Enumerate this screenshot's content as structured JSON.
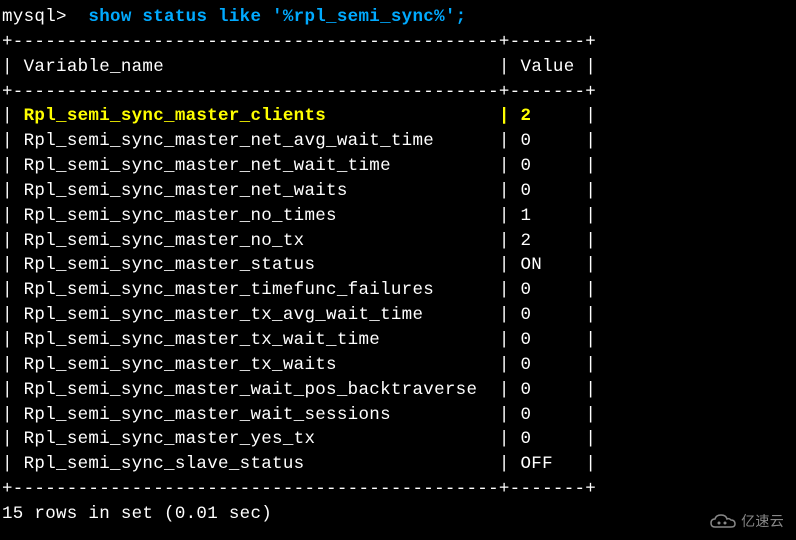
{
  "prompt": "mysql>  ",
  "command": "show status like '%rpl_semi_sync%';",
  "separator_top": "+---------------------------------------------+-------+",
  "header": {
    "col1": "Variable_name",
    "col2": "Value"
  },
  "rows": [
    {
      "name": "Rpl_semi_sync_master_clients",
      "value": "2",
      "highlight": true
    },
    {
      "name": "Rpl_semi_sync_master_net_avg_wait_time",
      "value": "0",
      "highlight": false
    },
    {
      "name": "Rpl_semi_sync_master_net_wait_time",
      "value": "0",
      "highlight": false
    },
    {
      "name": "Rpl_semi_sync_master_net_waits",
      "value": "0",
      "highlight": false
    },
    {
      "name": "Rpl_semi_sync_master_no_times",
      "value": "1",
      "highlight": false
    },
    {
      "name": "Rpl_semi_sync_master_no_tx",
      "value": "2",
      "highlight": false
    },
    {
      "name": "Rpl_semi_sync_master_status",
      "value": "ON",
      "highlight": false
    },
    {
      "name": "Rpl_semi_sync_master_timefunc_failures",
      "value": "0",
      "highlight": false
    },
    {
      "name": "Rpl_semi_sync_master_tx_avg_wait_time",
      "value": "0",
      "highlight": false
    },
    {
      "name": "Rpl_semi_sync_master_tx_wait_time",
      "value": "0",
      "highlight": false
    },
    {
      "name": "Rpl_semi_sync_master_tx_waits",
      "value": "0",
      "highlight": false
    },
    {
      "name": "Rpl_semi_sync_master_wait_pos_backtraverse",
      "value": "0",
      "highlight": false
    },
    {
      "name": "Rpl_semi_sync_master_wait_sessions",
      "value": "0",
      "highlight": false
    },
    {
      "name": "Rpl_semi_sync_master_yes_tx",
      "value": "0",
      "highlight": false
    },
    {
      "name": "Rpl_semi_sync_slave_status",
      "value": "OFF",
      "highlight": false
    }
  ],
  "result_summary": "15 rows in set (0.01 sec)",
  "watermark": "亿速云",
  "chart_data": {
    "type": "table",
    "title": "MySQL Semi-Sync Replication Status",
    "columns": [
      "Variable_name",
      "Value"
    ],
    "data": [
      [
        "Rpl_semi_sync_master_clients",
        "2"
      ],
      [
        "Rpl_semi_sync_master_net_avg_wait_time",
        "0"
      ],
      [
        "Rpl_semi_sync_master_net_wait_time",
        "0"
      ],
      [
        "Rpl_semi_sync_master_net_waits",
        "0"
      ],
      [
        "Rpl_semi_sync_master_no_times",
        "1"
      ],
      [
        "Rpl_semi_sync_master_no_tx",
        "2"
      ],
      [
        "Rpl_semi_sync_master_status",
        "ON"
      ],
      [
        "Rpl_semi_sync_master_timefunc_failures",
        "0"
      ],
      [
        "Rpl_semi_sync_master_tx_avg_wait_time",
        "0"
      ],
      [
        "Rpl_semi_sync_master_tx_wait_time",
        "0"
      ],
      [
        "Rpl_semi_sync_master_tx_waits",
        "0"
      ],
      [
        "Rpl_semi_sync_master_wait_pos_backtraverse",
        "0"
      ],
      [
        "Rpl_semi_sync_master_wait_sessions",
        "0"
      ],
      [
        "Rpl_semi_sync_master_yes_tx",
        "0"
      ],
      [
        "Rpl_semi_sync_slave_status",
        "OFF"
      ]
    ]
  }
}
